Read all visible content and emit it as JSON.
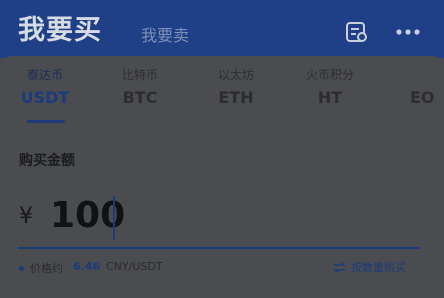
{
  "header": {
    "active_tab": "我要买",
    "other_tab": "我要卖"
  },
  "coins": [
    {
      "name": "泰达币",
      "code": "USDT",
      "active": true
    },
    {
      "name": "比特币",
      "code": "BTC",
      "active": false
    },
    {
      "name": "以太坊",
      "code": "ETH",
      "active": false
    },
    {
      "name": "火币积分",
      "code": "HT",
      "active": false
    },
    {
      "name": "",
      "code": "EO",
      "active": false
    }
  ],
  "amount": {
    "label": "购买金额",
    "currency_symbol": "¥",
    "value": "100"
  },
  "price": {
    "label": "价格约",
    "value": "6.46",
    "unit": "CNY/USDT"
  },
  "switch_mode": {
    "label": "按数量购买"
  },
  "colors": {
    "header_bg": "#1f3f86",
    "accent": "#1c3b7e",
    "card_bg": "#4b4c4f"
  },
  "icons": {
    "orders": "order-list-icon",
    "more": "more-dots-icon",
    "switch": "swap-arrows-icon"
  }
}
